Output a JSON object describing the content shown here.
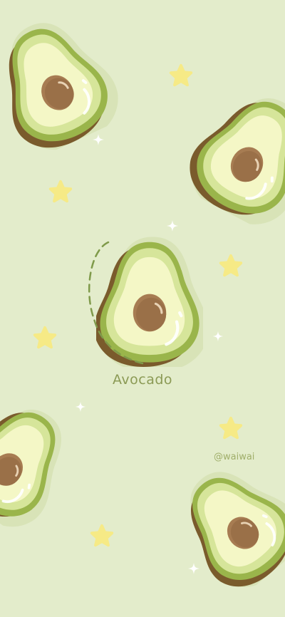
{
  "title_text": "Avocado",
  "artist_handle": "@waiwai",
  "palette": {
    "background": "#e3eccb",
    "skin_dark": "#7a5b2c",
    "skin_green": "#9ab54b",
    "flesh_outer": "#d6e59a",
    "flesh_inner": "#f4f7c6",
    "pit": "#a77c52",
    "star": "#f6ea86",
    "sparkle": "#ffffff"
  },
  "icons": [
    "avocado-half",
    "star-icon",
    "sparkle-icon"
  ]
}
